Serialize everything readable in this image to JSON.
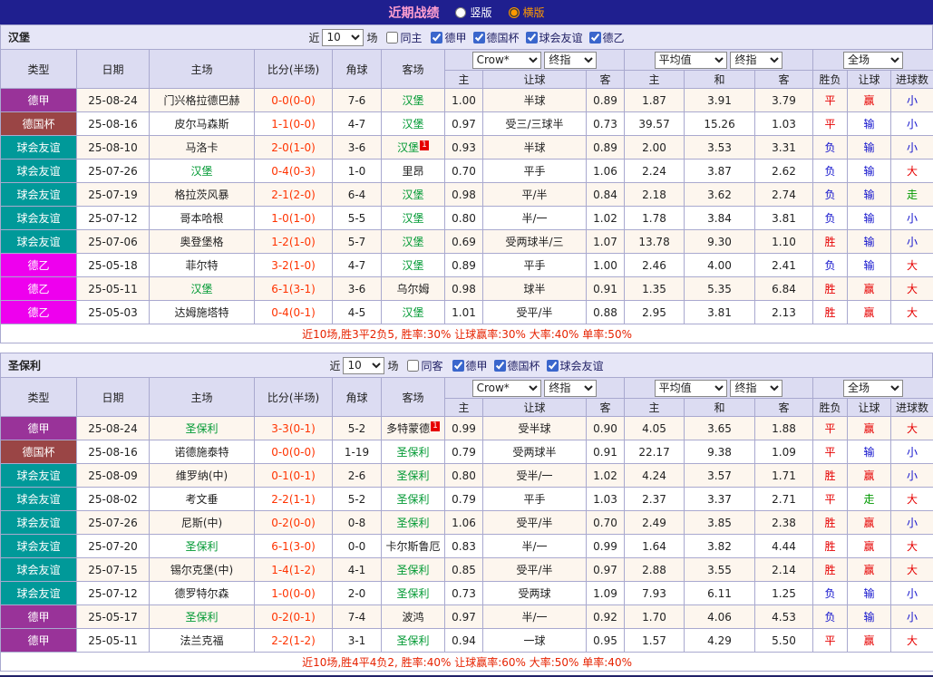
{
  "titlebar": {
    "title": "近期战绩",
    "options": [
      {
        "label": "竖版",
        "selected": false
      },
      {
        "label": "横版",
        "selected": true
      }
    ]
  },
  "type_colors": {
    "德甲": "#993399",
    "德国杯": "#9a4545",
    "球会友谊": "#009999",
    "德乙": "#ee00ee"
  },
  "result_colors": {
    "胜": "#e60000",
    "平": "#e60000",
    "负": "#1111cc",
    "赢": "#e60000",
    "输": "#1111cc",
    "走": "#009900",
    "大": "#e60000",
    "小": "#1111cc"
  },
  "table_headers": {
    "type": "类型",
    "date": "日期",
    "home": "主场",
    "score": "比分(半场)",
    "corner": "角球",
    "away": "客场",
    "h": "主",
    "handicap": "让球",
    "a": "客",
    "avg_d": "和",
    "result": "胜负",
    "goals": "进球数"
  },
  "sections": [
    {
      "team": "汉堡",
      "filter": {
        "near_label": "近",
        "count": "10",
        "field_label": "场",
        "same_label": "同主",
        "same_checked": false,
        "leagues": [
          {
            "label": "德甲",
            "checked": true
          },
          {
            "label": "德国杯",
            "checked": true
          },
          {
            "label": "球会友谊",
            "checked": true
          },
          {
            "label": "德乙",
            "checked": true
          }
        ]
      },
      "selects": {
        "odds_src": "Crow*",
        "odds_final": "终指",
        "avg_src": "平均值",
        "avg_final": "终指",
        "full": "全场"
      },
      "rows": [
        {
          "type": "德甲",
          "date": "25-08-24",
          "home": "门兴格拉德巴赫",
          "home_hl": false,
          "score": "0-0(0-0)",
          "corner": "7-6",
          "away": "汉堡",
          "away_hl": true,
          "away_sup": "",
          "h": "1.00",
          "handicap": "半球",
          "a": "0.89",
          "avg_h": "1.87",
          "avg_d": "3.91",
          "avg_a": "3.79",
          "result": "平",
          "handicap_result": "赢",
          "goals": "小"
        },
        {
          "type": "德国杯",
          "date": "25-08-16",
          "home": "皮尔马森斯",
          "home_hl": false,
          "score": "1-1(0-0)",
          "corner": "4-7",
          "away": "汉堡",
          "away_hl": true,
          "away_sup": "",
          "h": "0.97",
          "handicap": "受三/三球半",
          "a": "0.73",
          "avg_h": "39.57",
          "avg_d": "15.26",
          "avg_a": "1.03",
          "result": "平",
          "handicap_result": "输",
          "goals": "小"
        },
        {
          "type": "球会友谊",
          "date": "25-08-10",
          "home": "马洛卡",
          "home_hl": false,
          "score": "2-0(1-0)",
          "corner": "3-6",
          "away": "汉堡",
          "away_hl": true,
          "away_sup": "1",
          "h": "0.93",
          "handicap": "半球",
          "a": "0.89",
          "avg_h": "2.00",
          "avg_d": "3.53",
          "avg_a": "3.31",
          "result": "负",
          "handicap_result": "输",
          "goals": "小"
        },
        {
          "type": "球会友谊",
          "date": "25-07-26",
          "home": "汉堡",
          "home_hl": true,
          "score": "0-4(0-3)",
          "corner": "1-0",
          "away": "里昂",
          "away_hl": false,
          "away_sup": "",
          "h": "0.70",
          "handicap": "平手",
          "a": "1.06",
          "avg_h": "2.24",
          "avg_d": "3.87",
          "avg_a": "2.62",
          "result": "负",
          "handicap_result": "输",
          "goals": "大"
        },
        {
          "type": "球会友谊",
          "date": "25-07-19",
          "home": "格拉茨风暴",
          "home_hl": false,
          "score": "2-1(2-0)",
          "corner": "6-4",
          "away": "汉堡",
          "away_hl": true,
          "away_sup": "",
          "h": "0.98",
          "handicap": "平/半",
          "a": "0.84",
          "avg_h": "2.18",
          "avg_d": "3.62",
          "avg_a": "2.74",
          "result": "负",
          "handicap_result": "输",
          "goals": "走"
        },
        {
          "type": "球会友谊",
          "date": "25-07-12",
          "home": "哥本哈根",
          "home_hl": false,
          "score": "1-0(1-0)",
          "corner": "5-5",
          "away": "汉堡",
          "away_hl": true,
          "away_sup": "",
          "h": "0.80",
          "handicap": "半/一",
          "a": "1.02",
          "avg_h": "1.78",
          "avg_d": "3.84",
          "avg_a": "3.81",
          "result": "负",
          "handicap_result": "输",
          "goals": "小"
        },
        {
          "type": "球会友谊",
          "date": "25-07-06",
          "home": "奥登堡格",
          "home_hl": false,
          "score": "1-2(1-0)",
          "corner": "5-7",
          "away": "汉堡",
          "away_hl": true,
          "away_sup": "",
          "h": "0.69",
          "handicap": "受两球半/三",
          "a": "1.07",
          "avg_h": "13.78",
          "avg_d": "9.30",
          "avg_a": "1.10",
          "result": "胜",
          "handicap_result": "输",
          "goals": "小"
        },
        {
          "type": "德乙",
          "date": "25-05-18",
          "home": "菲尔特",
          "home_hl": false,
          "score": "3-2(1-0)",
          "corner": "4-7",
          "away": "汉堡",
          "away_hl": true,
          "away_sup": "",
          "h": "0.89",
          "handicap": "平手",
          "a": "1.00",
          "avg_h": "2.46",
          "avg_d": "4.00",
          "avg_a": "2.41",
          "result": "负",
          "handicap_result": "输",
          "goals": "大"
        },
        {
          "type": "德乙",
          "date": "25-05-11",
          "home": "汉堡",
          "home_hl": true,
          "score": "6-1(3-1)",
          "corner": "3-6",
          "away": "乌尔姆",
          "away_hl": false,
          "away_sup": "",
          "h": "0.98",
          "handicap": "球半",
          "a": "0.91",
          "avg_h": "1.35",
          "avg_d": "5.35",
          "avg_a": "6.84",
          "result": "胜",
          "handicap_result": "赢",
          "goals": "大"
        },
        {
          "type": "德乙",
          "date": "25-05-03",
          "home": "达姆施塔特",
          "home_hl": false,
          "score": "0-4(0-1)",
          "corner": "4-5",
          "away": "汉堡",
          "away_hl": true,
          "away_sup": "",
          "h": "1.01",
          "handicap": "受平/半",
          "a": "0.88",
          "avg_h": "2.95",
          "avg_d": "3.81",
          "avg_a": "2.13",
          "result": "胜",
          "handicap_result": "赢",
          "goals": "大"
        }
      ],
      "summary": "近10场,胜3平2负5, 胜率:30% 让球赢率:30% 大率:40% 单率:50%"
    },
    {
      "team": "圣保利",
      "filter": {
        "near_label": "近",
        "count": "10",
        "field_label": "场",
        "same_label": "同客",
        "same_checked": false,
        "leagues": [
          {
            "label": "德甲",
            "checked": true
          },
          {
            "label": "德国杯",
            "checked": true
          },
          {
            "label": "球会友谊",
            "checked": true
          }
        ]
      },
      "selects": {
        "odds_src": "Crow*",
        "odds_final": "终指",
        "avg_src": "平均值",
        "avg_final": "终指",
        "full": "全场"
      },
      "rows": [
        {
          "type": "德甲",
          "date": "25-08-24",
          "home": "圣保利",
          "home_hl": true,
          "score": "3-3(0-1)",
          "corner": "5-2",
          "away": "多特蒙德",
          "away_hl": false,
          "away_sup": "1",
          "h": "0.99",
          "handicap": "受半球",
          "a": "0.90",
          "avg_h": "4.05",
          "avg_d": "3.65",
          "avg_a": "1.88",
          "result": "平",
          "handicap_result": "赢",
          "goals": "大"
        },
        {
          "type": "德国杯",
          "date": "25-08-16",
          "home": "诺德施泰特",
          "home_hl": false,
          "score": "0-0(0-0)",
          "corner": "1-19",
          "away": "圣保利",
          "away_hl": true,
          "away_sup": "",
          "h": "0.79",
          "handicap": "受两球半",
          "a": "0.91",
          "avg_h": "22.17",
          "avg_d": "9.38",
          "avg_a": "1.09",
          "result": "平",
          "handicap_result": "输",
          "goals": "小"
        },
        {
          "type": "球会友谊",
          "date": "25-08-09",
          "home": "维罗纳(中)",
          "home_hl": false,
          "score": "0-1(0-1)",
          "corner": "2-6",
          "away": "圣保利",
          "away_hl": true,
          "away_sup": "",
          "h": "0.80",
          "handicap": "受半/一",
          "a": "1.02",
          "avg_h": "4.24",
          "avg_d": "3.57",
          "avg_a": "1.71",
          "result": "胜",
          "handicap_result": "赢",
          "goals": "小"
        },
        {
          "type": "球会友谊",
          "date": "25-08-02",
          "home": "考文垂",
          "home_hl": false,
          "score": "2-2(1-1)",
          "corner": "5-2",
          "away": "圣保利",
          "away_hl": true,
          "away_sup": "",
          "h": "0.79",
          "handicap": "平手",
          "a": "1.03",
          "avg_h": "2.37",
          "avg_d": "3.37",
          "avg_a": "2.71",
          "result": "平",
          "handicap_result": "走",
          "goals": "大"
        },
        {
          "type": "球会友谊",
          "date": "25-07-26",
          "home": "尼斯(中)",
          "home_hl": false,
          "score": "0-2(0-0)",
          "corner": "0-8",
          "away": "圣保利",
          "away_hl": true,
          "away_sup": "",
          "h": "1.06",
          "handicap": "受平/半",
          "a": "0.70",
          "avg_h": "2.49",
          "avg_d": "3.85",
          "avg_a": "2.38",
          "result": "胜",
          "handicap_result": "赢",
          "goals": "小"
        },
        {
          "type": "球会友谊",
          "date": "25-07-20",
          "home": "圣保利",
          "home_hl": true,
          "score": "6-1(3-0)",
          "corner": "0-0",
          "away": "卡尔斯鲁厄",
          "away_hl": false,
          "away_sup": "",
          "h": "0.83",
          "handicap": "半/一",
          "a": "0.99",
          "avg_h": "1.64",
          "avg_d": "3.82",
          "avg_a": "4.44",
          "result": "胜",
          "handicap_result": "赢",
          "goals": "大"
        },
        {
          "type": "球会友谊",
          "date": "25-07-15",
          "home": "锡尔克堡(中)",
          "home_hl": false,
          "score": "1-4(1-2)",
          "corner": "4-1",
          "away": "圣保利",
          "away_hl": true,
          "away_sup": "",
          "h": "0.85",
          "handicap": "受平/半",
          "a": "0.97",
          "avg_h": "2.88",
          "avg_d": "3.55",
          "avg_a": "2.14",
          "result": "胜",
          "handicap_result": "赢",
          "goals": "大"
        },
        {
          "type": "球会友谊",
          "date": "25-07-12",
          "home": "德罗特尔森",
          "home_hl": false,
          "score": "1-0(0-0)",
          "corner": "2-0",
          "away": "圣保利",
          "away_hl": true,
          "away_sup": "",
          "h": "0.73",
          "handicap": "受两球",
          "a": "1.09",
          "avg_h": "7.93",
          "avg_d": "6.11",
          "avg_a": "1.25",
          "result": "负",
          "handicap_result": "输",
          "goals": "小"
        },
        {
          "type": "德甲",
          "date": "25-05-17",
          "home": "圣保利",
          "home_hl": true,
          "score": "0-2(0-1)",
          "corner": "7-4",
          "away": "波鸿",
          "away_hl": false,
          "away_sup": "",
          "h": "0.97",
          "handicap": "半/一",
          "a": "0.92",
          "avg_h": "1.70",
          "avg_d": "4.06",
          "avg_a": "4.53",
          "result": "负",
          "handicap_result": "输",
          "goals": "小"
        },
        {
          "type": "德甲",
          "date": "25-05-11",
          "home": "法兰克福",
          "home_hl": false,
          "score": "2-2(1-2)",
          "corner": "3-1",
          "away": "圣保利",
          "away_hl": true,
          "away_sup": "",
          "h": "0.94",
          "handicap": "一球",
          "a": "0.95",
          "avg_h": "1.57",
          "avg_d": "4.29",
          "avg_a": "5.50",
          "result": "平",
          "handicap_result": "赢",
          "goals": "大"
        }
      ],
      "summary": "近10场,胜4平4负2, 胜率:40% 让球赢率:60% 大率:50% 单率:40%"
    }
  ]
}
